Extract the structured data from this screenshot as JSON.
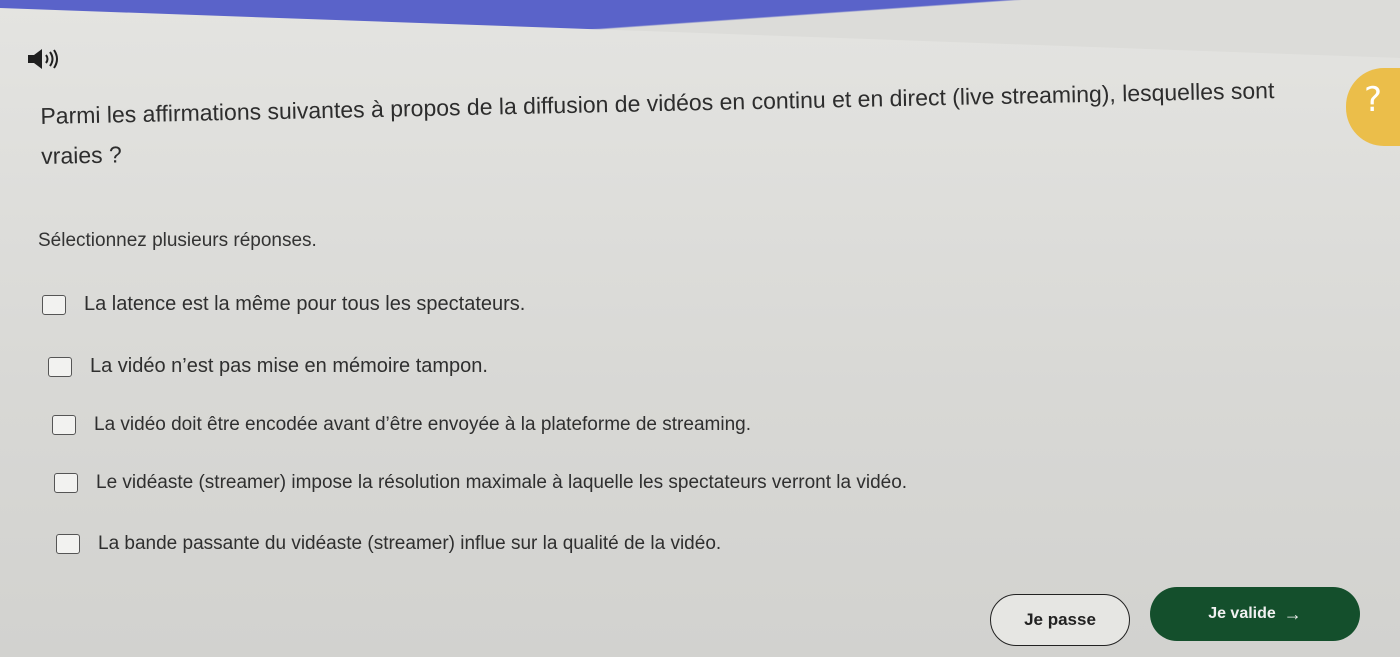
{
  "question": {
    "text": "Parmi les affirmations suivantes à propos de la diffusion de vidéos en continu et en direct (live streaming), lesquelles sont vraies ?"
  },
  "instruction": "Sélectionnez plusieurs réponses.",
  "options": [
    {
      "label": "La latence est la même pour tous les spectateurs."
    },
    {
      "label": "La vidéo n’est pas mise en mémoire tampon."
    },
    {
      "label": "La vidéo doit être encodée avant d’être envoyée à la plateforme de streaming."
    },
    {
      "label": "Le vidéaste (streamer) impose la résolution maximale à laquelle les spectateurs verront la vidéo."
    },
    {
      "label": "La bande passante du vidéaste (streamer) influe sur la qualité de la vidéo."
    }
  ],
  "buttons": {
    "skip_label": "Je passe",
    "validate_label": "Je valide",
    "validate_arrow": "→"
  },
  "help": {
    "symbol": "?"
  },
  "colors": {
    "header_blue": "#5a63c9",
    "validate_green": "#144f2c",
    "help_yellow": "#ebbe4a"
  },
  "icons": [
    "speaker-icon",
    "help-icon",
    "arrow-right-icon"
  ]
}
